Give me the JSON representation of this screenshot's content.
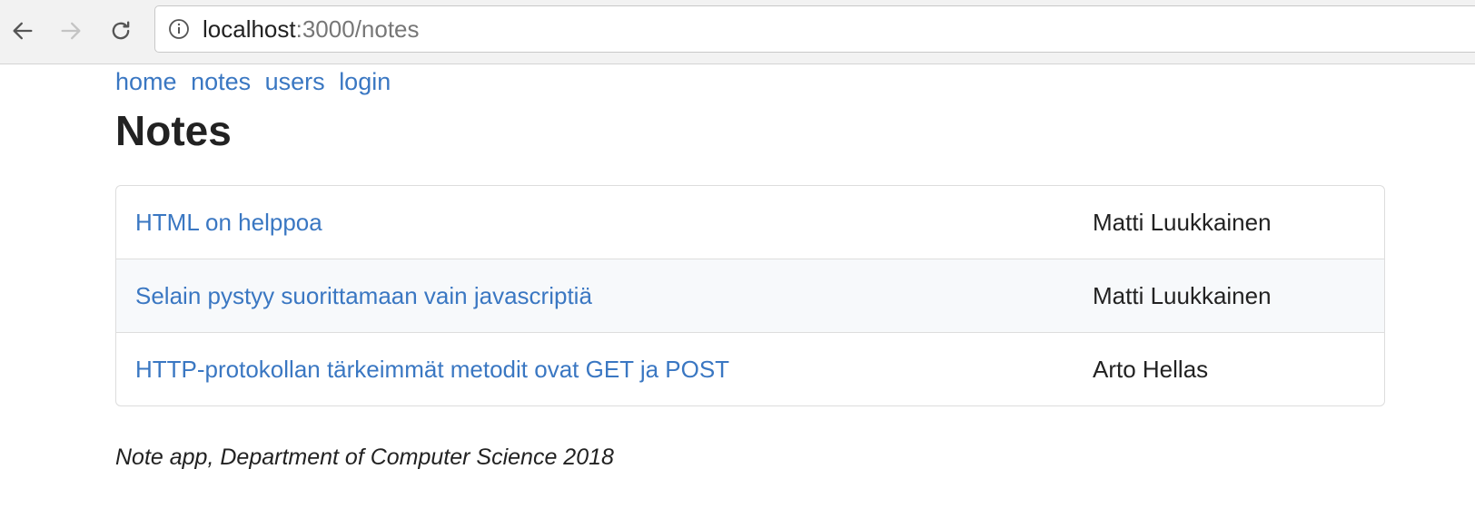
{
  "browser": {
    "url_host": "localhost",
    "url_path": ":3000/notes"
  },
  "menu": {
    "items": [
      "home",
      "notes",
      "users",
      "login"
    ]
  },
  "page": {
    "title": "Notes"
  },
  "notes": [
    {
      "content": "HTML on helppoa",
      "user": "Matti Luukkainen"
    },
    {
      "content": "Selain pystyy suorittamaan vain javascriptiä",
      "user": "Matti Luukkainen"
    },
    {
      "content": "HTTP-protokollan tärkeimmät metodit ovat GET ja POST",
      "user": "Arto Hellas"
    }
  ],
  "footer": {
    "text": "Note app, Department of Computer Science 2018"
  },
  "colors": {
    "link": "#3a77c2",
    "text": "#222222",
    "row_stripe": "#f7f9fb",
    "border": "#dddddd"
  }
}
